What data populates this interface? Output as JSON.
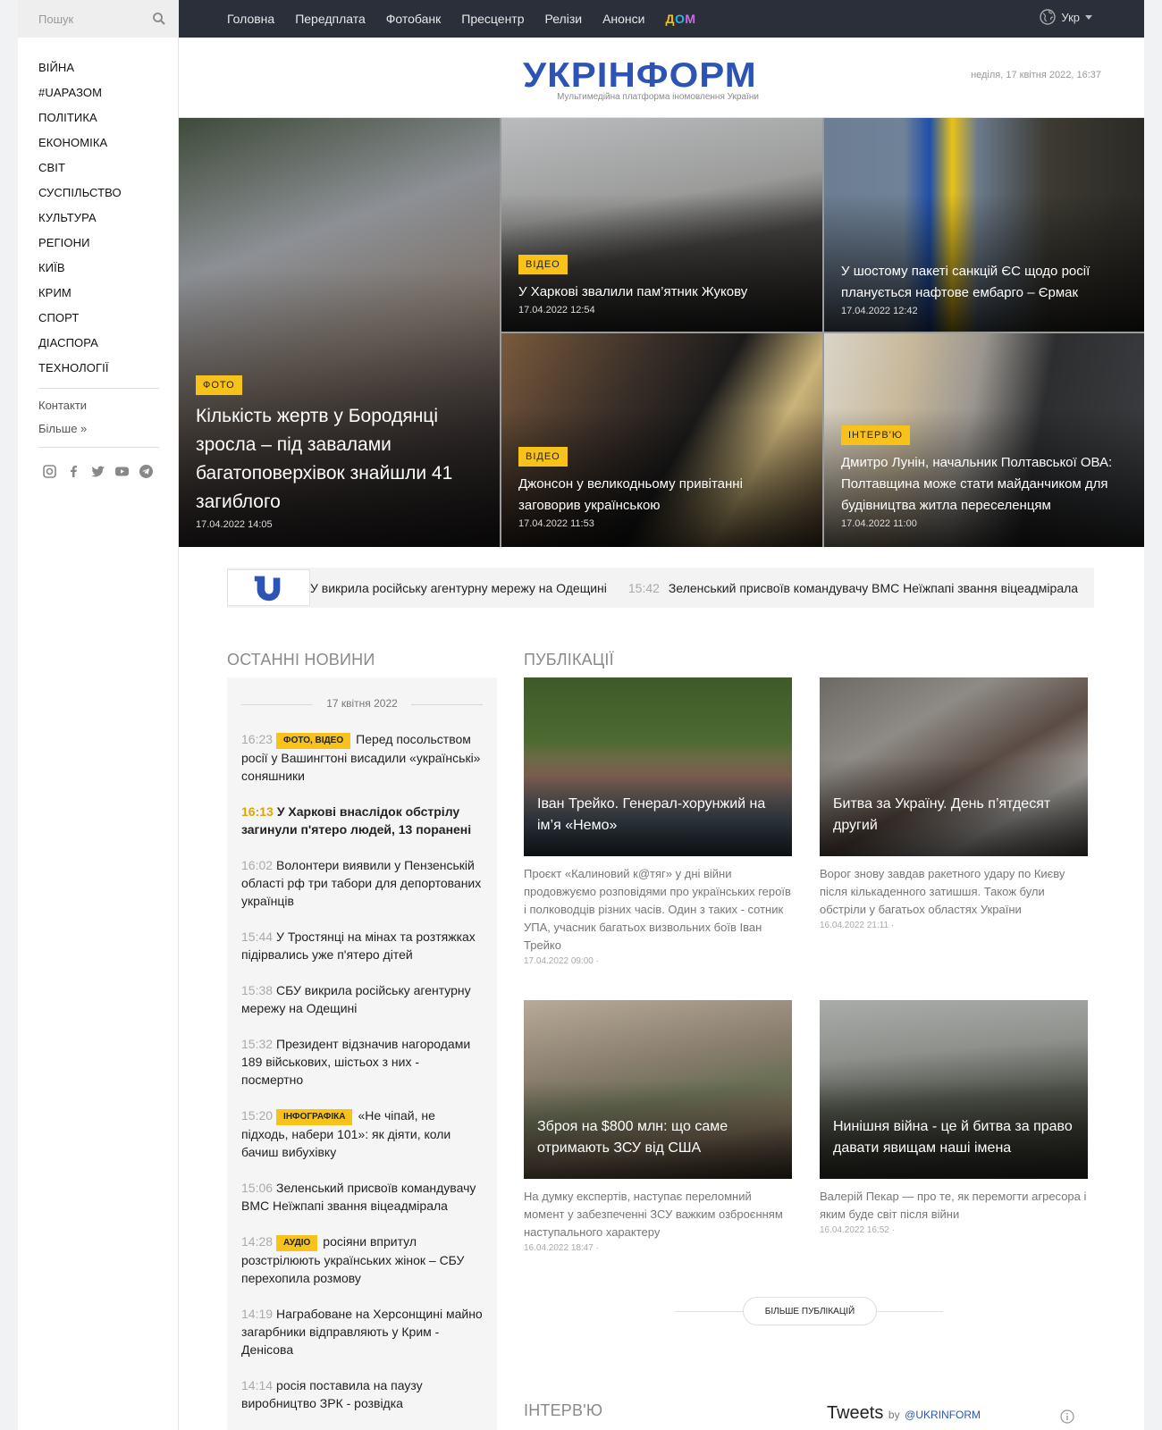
{
  "search": {
    "placeholder": "Пошук"
  },
  "sidebar": {
    "items": [
      {
        "label": "ВІЙНА"
      },
      {
        "label": "#UAРАЗОМ"
      },
      {
        "label": "ПОЛІТИКА"
      },
      {
        "label": "ЕКОНОМІКА"
      },
      {
        "label": "СВІТ"
      },
      {
        "label": "СУСПІЛЬСТВО"
      },
      {
        "label": "КУЛЬТУРА"
      },
      {
        "label": "РЕГІОНИ"
      },
      {
        "label": "КИЇВ"
      },
      {
        "label": "КРИМ"
      },
      {
        "label": "СПОРТ"
      },
      {
        "label": "ДІАСПОРА"
      },
      {
        "label": "ТЕХНОЛОГІЇ"
      }
    ],
    "contacts": "Контакти",
    "more": "Більше »",
    "social": [
      "instagram-icon",
      "facebook-icon",
      "twitter-icon",
      "youtube-icon",
      "telegram-icon"
    ]
  },
  "topnav": {
    "items": [
      "Головна",
      "Передплата",
      "Фотобанк",
      "Пресцентр",
      "Релізи",
      "Анонси"
    ],
    "dom_logo": "ДОМ",
    "lang": "Укр"
  },
  "header": {
    "logo": "УКРІНФОРМ",
    "tagline": "Мультимедійна платформа іномовлення України",
    "date": "неділя, 17 квітня 2022, 16:37"
  },
  "top_stories": [
    {
      "badge": "ФОТО",
      "title": "Кількість жертв у Бородянці зросла – під завалами багатоповерхівок знайшли 41 загиблого",
      "time": "17.04.2022 14:05"
    },
    {
      "badge": "ВІДЕО",
      "title": "У Харкові звалили пам’ятник Жукову",
      "time": "17.04.2022 12:54"
    },
    {
      "badge": "",
      "title": "У шостому пакеті санкцій ЄС щодо росії планується нафтове ембарго – Єрмак",
      "time": "17.04.2022 12:42"
    },
    {
      "badge": "ВІДЕО",
      "title": "Джонсон у великодньому привітанні заговорив українською",
      "time": "17.04.2022 11:53"
    },
    {
      "badge": "ІНТЕРВ'Ю",
      "title": "Дмитро Лунін, начальник Полтавської ОВА: Полтавщина може стати майданчиком для будівництва житла переселенцям",
      "time": "17.04.2022 11:00"
    }
  ],
  "ticker": {
    "item1": "У викрила російську агентурну мережу на Одещині",
    "time2": "15:42",
    "item2": "Зеленський присвоїв командувачу ВМС Неїжпапі звання віцеадмірала"
  },
  "latest": {
    "title": "ОСТАННІ НОВИНИ",
    "date": "17 квітня 2022",
    "items": [
      {
        "time": "16:23",
        "badge": "ФОТО, ВІДЕО",
        "text": "Перед посольством росії у Вашингтоні висадили «українські» соняшники"
      },
      {
        "time": "16:13",
        "badge": "",
        "text": "У Харкові внаслідок обстрілу загинули п'ятеро людей, 13 поранені"
      },
      {
        "time": "16:02",
        "badge": "",
        "text": "Волонтери виявили у Пензенській області рф три табори для депортованих українців"
      },
      {
        "time": "15:44",
        "badge": "",
        "text": "У Тростянці на мінах та розтяжках підірвались уже п'ятеро дітей"
      },
      {
        "time": "15:38",
        "badge": "",
        "text": "СБУ викрила російську агентурну мережу на Одещині"
      },
      {
        "time": "15:32",
        "badge": "",
        "text": "Президент відзначив нагородами 189 військових, шістьох з них - посмертно"
      },
      {
        "time": "15:20",
        "badge": "ІНФОГРАФІКА",
        "text": "«Не чіпай, не підходь, набери 101»: як діяти, коли бачиш вибухівку"
      },
      {
        "time": "15:06",
        "badge": "",
        "text": "Зеленський присвоїв командувачу ВМС Неїжпапі звання віцеадмірала"
      },
      {
        "time": "14:28",
        "badge": "АУДІО",
        "text": "росіяни впритул розстрілюють українських жінок – СБУ перехопила розмову"
      },
      {
        "time": "14:19",
        "badge": "",
        "text": "Награбоване на Херсонщині майно загарбники відправляють у Крим - Денісова"
      },
      {
        "time": "14:14",
        "badge": "",
        "text": "росія поставила на паузу виробництво ЗРК - розвідка"
      }
    ]
  },
  "publications": {
    "title": "ПУБЛІКАЦІЇ",
    "items": [
      {
        "title": "Іван Трейко. Генерал-хорунжий на ім’я «Немо»",
        "desc": "Проєкт «Калиновий к@тяг» у дні війни продовжуємо розповідями про українських героїв і полководців різних часів. Один з таких - сотник УПА, учасник багатьох визвольних боїв Іван Трейко",
        "time": "17.04.2022 09:00 ·"
      },
      {
        "title": "Битва за Україну. День п’ятдесят другий",
        "desc": "Ворог знову завдав ракетного удару по Києву після кількаденного затишшя. Також були обстріли у багатьох областях України",
        "time": "16.04.2022 21:11 ·"
      },
      {
        "title": "Зброя на $800 млн: що саме отримають ЗСУ від США",
        "desc": "На думку експертів, наступає переломний момент у забезпеченні ЗСУ важким озброєнням наступального характеру",
        "time": "16.04.2022 18:47 ·"
      },
      {
        "title": "Нинішня війна - це й битва за право давати явищам наші імена",
        "desc": "Валерій Пекар — про те, як перемогти агресора і яким буде світ після війни",
        "time": "16.04.2022 16:52 ·"
      }
    ],
    "more": "БІЛЬШЕ ПУБЛІКАЦІЙ"
  },
  "interview": {
    "title": "ІНТЕРВ'Ю"
  },
  "tweets": {
    "title": "Tweets",
    "by": "by",
    "handle": "@UKRINFORM"
  }
}
